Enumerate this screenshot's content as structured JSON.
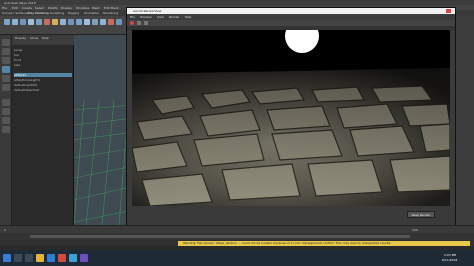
{
  "app": {
    "title": "Autodesk Maya 2018",
    "menus": [
      "File",
      "Edit",
      "Create",
      "Select",
      "Modify",
      "Display",
      "Windows",
      "Mesh",
      "Edit Mesh",
      "Mesh Tools",
      "Mesh Display",
      "Curves",
      "Surfaces",
      "Deform",
      "UV",
      "Generate",
      "Cache",
      "Arnold",
      "Help"
    ]
  },
  "shelf": {
    "tabs": [
      "Curves / Surfaces",
      "Poly Modeling",
      "Sculpting",
      "Rigging",
      "Animation",
      "Rendering",
      "FX",
      "FX Caching",
      "Custom",
      "Arnold",
      "Bifrost",
      "MASH",
      "Motion Graphics",
      "XGen"
    ]
  },
  "outliner": {
    "menus": [
      "Display",
      "Show",
      "Help"
    ],
    "items": [
      "persp",
      "top",
      "front",
      "side",
      "pPlane1",
      "aiSkyDomeLight1",
      "defaultLightSet",
      "defaultObjectSet"
    ],
    "selected_index": 4
  },
  "render_view": {
    "title": "Arnold RenderView",
    "menus": [
      "File",
      "Window",
      "View",
      "Render",
      "Help"
    ],
    "keep_label": "Keep Render"
  },
  "timeline": {
    "start": "1",
    "end": "120"
  },
  "status": {
    "warning": "Warning: File version: Maya_Version ... could not be loaded, because of a color management conflict. This may lead to unexpected results."
  },
  "taskbar": {
    "time": "1:03 PM",
    "date": "6/11/2018"
  },
  "colors": {
    "accent": "#5285a6",
    "warning": "#e8c84a",
    "grid": "#3fae5a"
  }
}
